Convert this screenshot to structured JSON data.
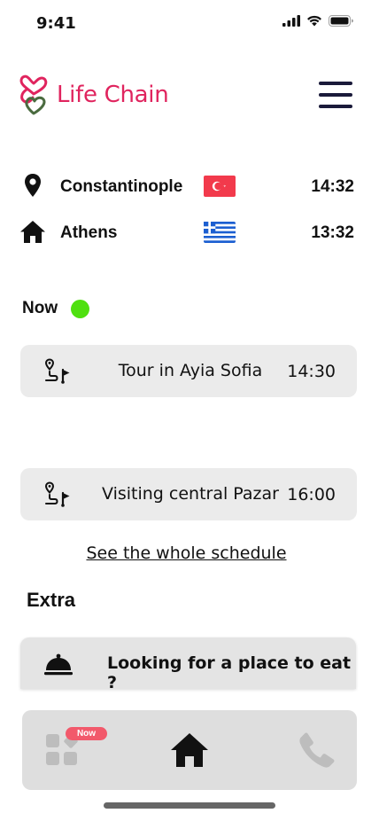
{
  "status_bar": {
    "time": "9:41"
  },
  "app": {
    "name": "Life Chain",
    "brand_color": "#e0245e"
  },
  "locations": [
    {
      "name": "Constantinople",
      "time": "14:32",
      "icon": "location-pin-icon",
      "flag": "turkey-flag-icon"
    },
    {
      "name": "Athens",
      "time": "13:32",
      "icon": "home-icon",
      "flag": "greece-flag-icon"
    }
  ],
  "now": {
    "label": "Now",
    "status_color": "#4fe010"
  },
  "events": [
    {
      "title": "Tour in Ayia Sofia",
      "time": "14:30",
      "icon": "route-flag-icon"
    },
    {
      "title": "Visiting central Pazar",
      "time": "16:00",
      "icon": "route-flag-icon"
    }
  ],
  "schedule_link": "See the whole schedule",
  "extra": {
    "title": "Extra",
    "items": [
      {
        "label": "Looking for a place to eat ?",
        "icon": "food-cloche-icon"
      }
    ]
  },
  "bottom_nav": {
    "items": [
      {
        "icon": "apps-grid-icon",
        "badge": "Now"
      },
      {
        "icon": "home-icon",
        "active": true
      },
      {
        "icon": "phone-icon"
      }
    ]
  }
}
